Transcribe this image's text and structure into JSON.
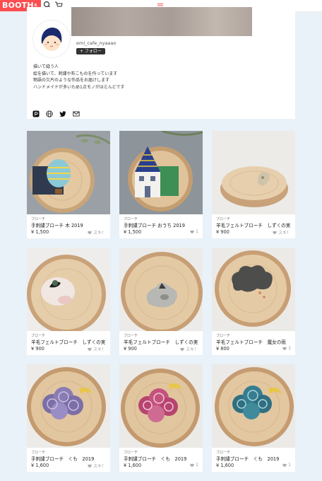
{
  "header": {
    "logo_text": "BOOTH",
    "logo_sup": "ß"
  },
  "profile": {
    "shop_name": "emi_cafe_nyaaao",
    "follow_label": "+ フォロー",
    "bio": [
      "描いて縫う人",
      "絵を描いて、刺繍や布こものを作っています",
      "",
      "物語の欠片のような作品をお届けします",
      "",
      "ハンドメイドが多いため1点モノがほとんどです"
    ]
  },
  "products": [
    {
      "category": "ブローチ",
      "name": "手刺繍ブローチ 木 2019",
      "price": "¥ 1,500",
      "likes": "スキ！",
      "image": "hot-air-balloon-brooch"
    },
    {
      "category": "ブローチ",
      "name": "手刺繍ブローチ おうち 2019",
      "price": "¥ 1,500",
      "likes": "1",
      "image": "house-brooch"
    },
    {
      "category": "ブローチ",
      "name": "羊毛フェルトブローチ　しずくの実",
      "price": "¥ 900",
      "likes": "スキ！",
      "image": "felt-drop-brooch"
    },
    {
      "category": "ブローチ",
      "name": "羊毛フェルトブローチ　しずくの実",
      "price": "¥ 900",
      "likes": "スキ！",
      "image": "felt-bird-brooch"
    },
    {
      "category": "ブローチ",
      "name": "羊毛フェルトブローチ　しずくの実",
      "price": "¥ 900",
      "likes": "スキ！",
      "image": "felt-grey-brooch"
    },
    {
      "category": "ブローチ",
      "name": "羊毛フェルトブローチ　魔女の雨",
      "price": "¥ 800",
      "likes": "1",
      "image": "felt-cloud-brooch"
    },
    {
      "category": "ブローチ",
      "name": "手刺繍ブローチ　くも　2019",
      "price": "¥ 1,600",
      "likes": "スキ！",
      "image": "purple-cloud-brooch"
    },
    {
      "category": "ブローチ",
      "name": "手刺繍ブローチ　くも　2019",
      "price": "¥ 1,600",
      "likes": "1",
      "image": "pink-cloud-brooch"
    },
    {
      "category": "ブローチ",
      "name": "手刺繍ブローチ　くも　2019",
      "price": "¥ 1,600",
      "likes": "1",
      "image": "teal-cloud-brooch"
    }
  ]
}
